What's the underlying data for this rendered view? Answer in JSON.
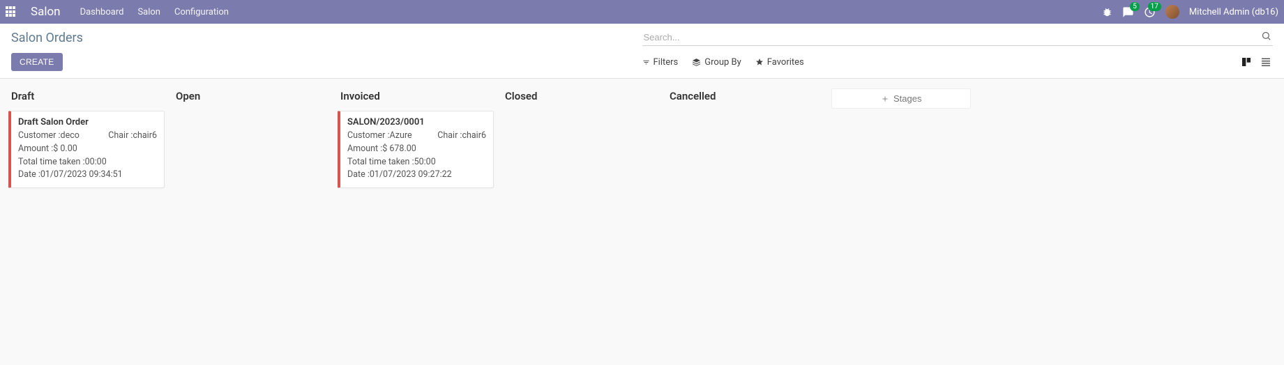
{
  "navbar": {
    "brand": "Salon",
    "menu": [
      "Dashboard",
      "Salon",
      "Configuration"
    ],
    "messages_badge": "5",
    "activities_badge": "17",
    "user": "Mitchell Admin (db16)"
  },
  "control_panel": {
    "title": "Salon Orders",
    "create_label": "CREATE",
    "search_placeholder": "Search...",
    "filters_label": "Filters",
    "groupby_label": "Group By",
    "favorites_label": "Favorites"
  },
  "kanban": {
    "columns": [
      {
        "title": "Draft"
      },
      {
        "title": "Open"
      },
      {
        "title": "Invoiced"
      },
      {
        "title": "Closed"
      },
      {
        "title": "Cancelled"
      }
    ],
    "stages_btn": "Stages",
    "cards": {
      "draft": {
        "title": "Draft Salon Order",
        "customer": "Customer :deco",
        "chair": "Chair :chair6",
        "amount": "Amount :$ 0.00",
        "time": "Total time taken :00:00",
        "date": "Date :01/07/2023 09:34:51"
      },
      "invoiced": {
        "title": "SALON/2023/0001",
        "customer": "Customer :Azure",
        "chair": "Chair :chair6",
        "amount": "Amount :$ 678.00",
        "time": "Total time taken :50:00",
        "date": "Date :01/07/2023 09:27:22"
      }
    }
  }
}
